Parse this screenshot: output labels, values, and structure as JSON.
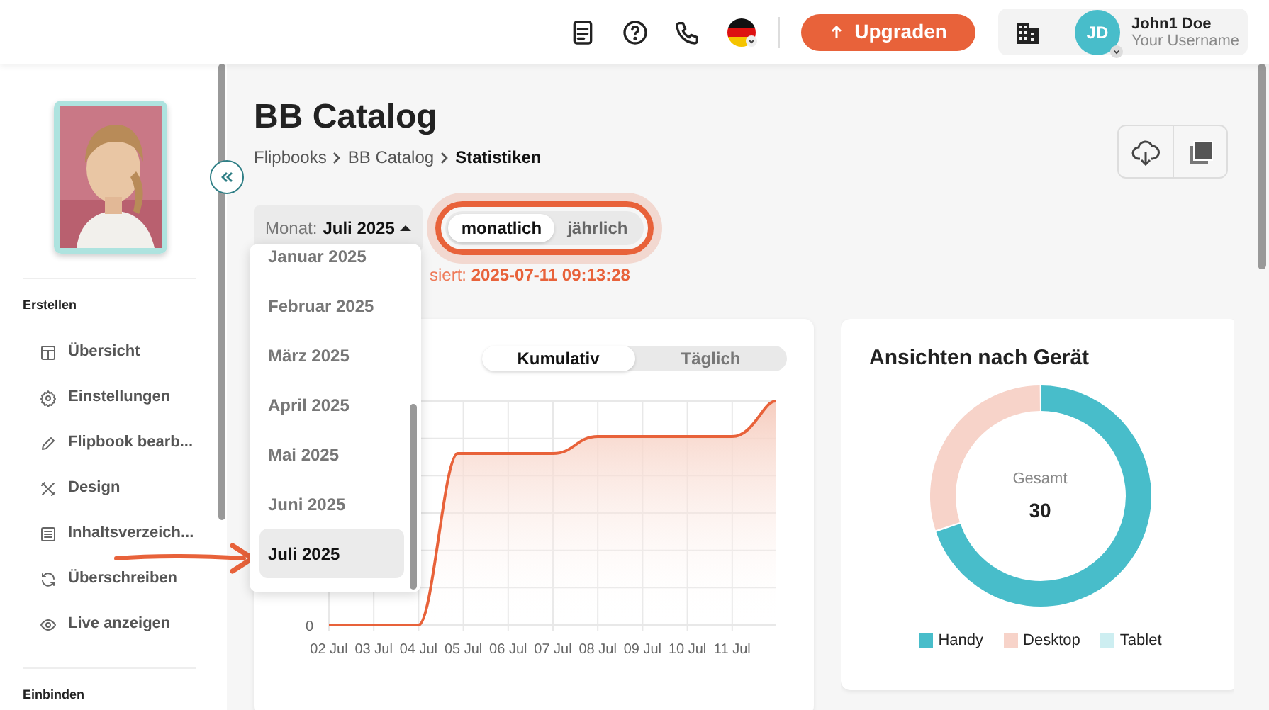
{
  "header": {
    "upgrade_button": "Upgraden",
    "user": {
      "initials": "JD",
      "name": "John1 Doe",
      "username": "Your Username"
    }
  },
  "sidebar": {
    "sections": [
      {
        "title": "Erstellen",
        "items": [
          {
            "label": "Übersicht"
          },
          {
            "label": "Einstellungen"
          },
          {
            "label": "Flipbook bearb..."
          },
          {
            "label": "Design"
          },
          {
            "label": "Inhaltsverzeich..."
          },
          {
            "label": "Überschreiben"
          },
          {
            "label": "Live anzeigen"
          }
        ]
      },
      {
        "title": "Einbinden"
      }
    ]
  },
  "page": {
    "title": "BB Catalog",
    "breadcrumb": [
      {
        "label": "Flipbooks",
        "current": false
      },
      {
        "label": "BB Catalog",
        "current": false
      },
      {
        "label": "Statistiken",
        "current": true
      }
    ]
  },
  "filters": {
    "month_label": "Monat:",
    "month_value": "Juli 2025",
    "expanded": true,
    "highlighted": true,
    "periods": [
      {
        "label": "monatlich",
        "selected": true
      },
      {
        "label": "jährlich",
        "selected": false
      }
    ]
  },
  "month_menu": [
    {
      "label": "Januar 2025",
      "selected": false
    },
    {
      "label": "Februar 2025",
      "selected": false
    },
    {
      "label": "März 2025",
      "selected": false
    },
    {
      "label": "April 2025",
      "selected": false
    },
    {
      "label": "Mai 2025",
      "selected": false
    },
    {
      "label": "Juni 2025",
      "selected": false
    },
    {
      "label": "Juli 2025",
      "selected": true
    }
  ],
  "sync": {
    "label": "siert:",
    "time": "2025-07-11 09:13:28"
  },
  "views_card": {
    "modes": [
      {
        "label": "Kumulativ",
        "selected": true
      },
      {
        "label": "Täglich",
        "selected": false
      }
    ],
    "y_label": "0",
    "x_labels": [
      "02 Jul",
      "03 Jul",
      "04 Jul",
      "05 Jul",
      "06 Jul",
      "07 Jul",
      "08 Jul",
      "09 Jul",
      "10 Jul",
      "11 Jul"
    ]
  },
  "device_card": {
    "title": "Ansichten nach Gerät",
    "total_label": "Gesamt",
    "total": "30",
    "legend": [
      {
        "label": "Handy",
        "color": "#48bdca"
      },
      {
        "label": "Desktop",
        "color": "#f7d3c9"
      },
      {
        "label": "Tablet",
        "color": "#cdeef1"
      }
    ]
  }
}
